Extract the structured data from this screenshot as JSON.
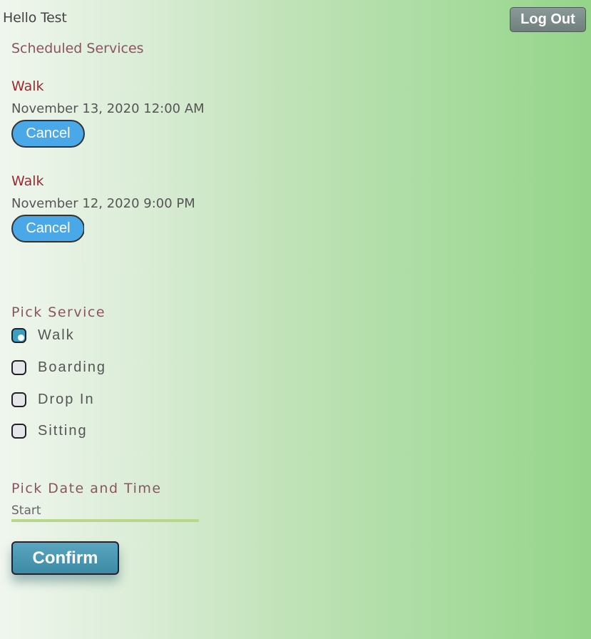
{
  "header": {
    "greeting": "Hello Test",
    "logout_label": "Log Out"
  },
  "scheduled": {
    "title": "Scheduled Services",
    "items": [
      {
        "service": "Walk",
        "datetime": "November 13, 2020 12:00 AM",
        "cancel_label": "Cancel"
      },
      {
        "service": "Walk",
        "datetime": "November 12, 2020 9:00 PM",
        "cancel_label": "Cancel"
      }
    ]
  },
  "pick_service": {
    "title": "Pick Service",
    "options": [
      {
        "label": "Walk",
        "checked": true
      },
      {
        "label": "Boarding",
        "checked": false
      },
      {
        "label": "Drop In",
        "checked": false
      },
      {
        "label": "Sitting",
        "checked": false
      }
    ]
  },
  "pick_datetime": {
    "title": "Pick Date and Time",
    "start_label": "Start"
  },
  "confirm_label": "Confirm",
  "colors": {
    "accent_button": "#4aa8e8",
    "service_name": "#9a2a30",
    "section_title": "#8a5560",
    "confirm_button": "#3d8aa6",
    "underline": "#b9d68b"
  }
}
